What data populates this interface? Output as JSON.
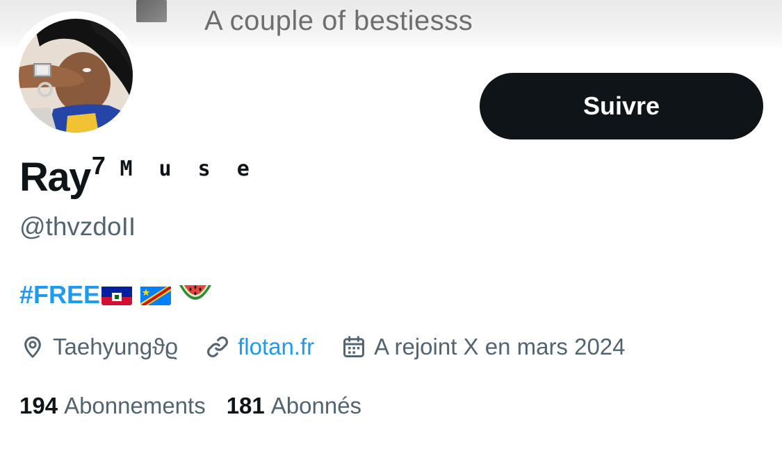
{
  "banner": {
    "caption": "A couple of bestiesss"
  },
  "profile": {
    "display_name": "Ray",
    "display_name_sup": "7",
    "display_name_suffix": "M u s e",
    "handle": "@thvzdoII",
    "bio_hashtag": "#FREE",
    "bio_emojis": [
      "haiti-flag",
      "drc-flag",
      "watermelon"
    ],
    "location": "Taehyungϑϱ",
    "website": "flotan.fr",
    "joined": "A rejoint X en mars 2024",
    "following_count": "194",
    "following_label": "Abonnements",
    "followers_count": "181",
    "followers_label": "Abonnés"
  },
  "actions": {
    "follow_label": "Suivre"
  },
  "colors": {
    "accent": "#1d9bf0",
    "text_primary": "#0f1419",
    "text_secondary": "#536471",
    "button_bg": "#0f1419"
  }
}
